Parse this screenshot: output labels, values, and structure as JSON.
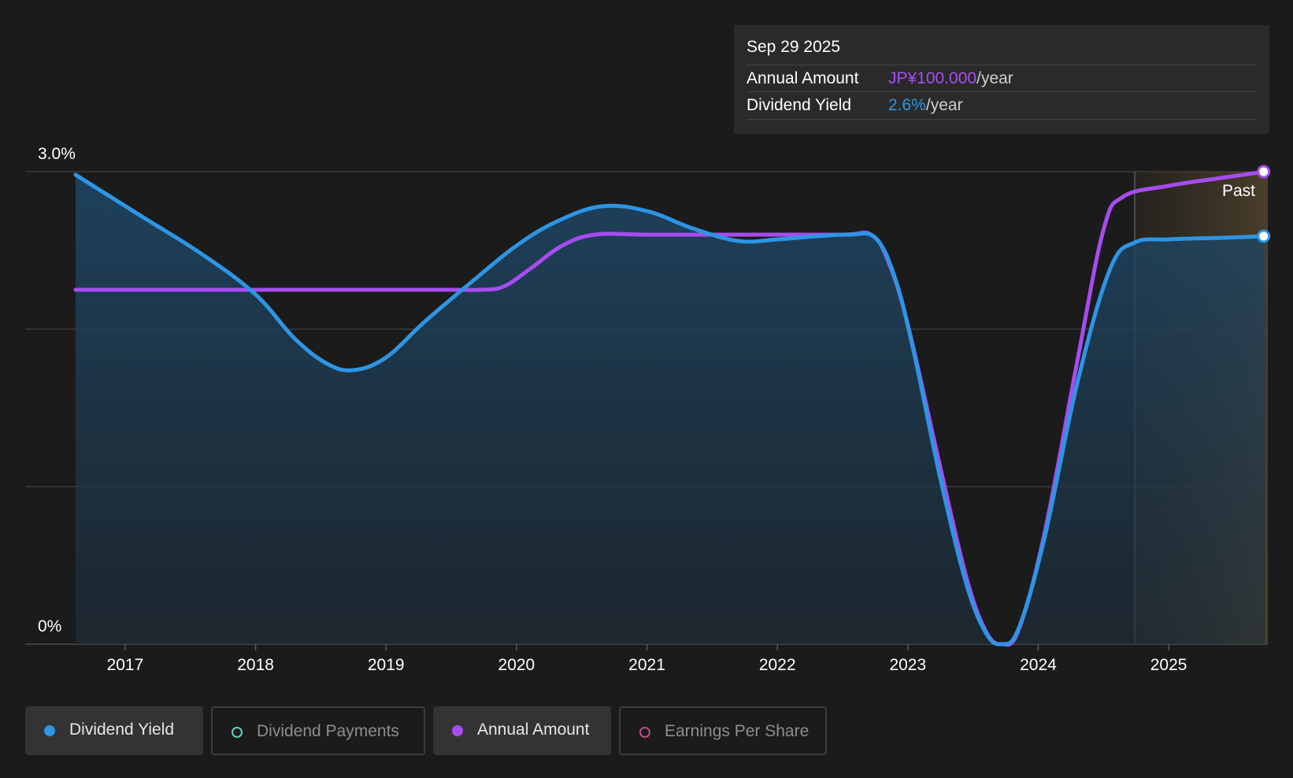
{
  "tooltip": {
    "date": "Sep 29 2025",
    "rows": [
      {
        "label": "Annual Amount",
        "value": "JP¥100.000",
        "unit": "/year"
      },
      {
        "label": "Dividend Yield",
        "value": "2.6%",
        "unit": "/year"
      }
    ]
  },
  "legend": [
    {
      "label": "Dividend Yield",
      "color": "#2d95e4",
      "active": true
    },
    {
      "label": "Dividend Payments",
      "color": "#5fcfbf",
      "active": false
    },
    {
      "label": "Annual Amount",
      "color": "#a74cf0",
      "active": true
    },
    {
      "label": "Earnings Per Share",
      "color": "#c04c8c",
      "active": false
    }
  ],
  "colors": {
    "background": "#1b1b1b",
    "dividend_yield": "#2d95e4",
    "annual_amount": "#a74cf0",
    "forecast_band": "#4a3d2a"
  },
  "chart_data": {
    "type": "line",
    "title": "",
    "xlabel": "",
    "ylabel": "",
    "xlim": [
      2016.62,
      2025.76
    ],
    "ylim": [
      0,
      3.0
    ],
    "y_ticks": [
      {
        "value": 3.0,
        "label": "3.0%"
      },
      {
        "value": 0,
        "label": "0%"
      }
    ],
    "gridlines": [
      3.0,
      2.0,
      1.0,
      0
    ],
    "x_ticks": [
      2017,
      2018,
      2019,
      2020,
      2021,
      2022,
      2023,
      2024,
      2025
    ],
    "x_tick_labels": [
      "2017",
      "2018",
      "2019",
      "2020",
      "2021",
      "2022",
      "2023",
      "2024",
      "2025"
    ],
    "past_marker": {
      "x": 2024.74,
      "label": "Past"
    },
    "series": [
      {
        "name": "Dividend Yield",
        "unit": "%",
        "points": [
          [
            2016.62,
            2.98
          ],
          [
            2017.1,
            2.73
          ],
          [
            2017.6,
            2.47
          ],
          [
            2018.0,
            2.22
          ],
          [
            2018.3,
            1.94
          ],
          [
            2018.55,
            1.78
          ],
          [
            2018.75,
            1.74
          ],
          [
            2019.0,
            1.82
          ],
          [
            2019.3,
            2.05
          ],
          [
            2019.7,
            2.33
          ],
          [
            2020.0,
            2.53
          ],
          [
            2020.3,
            2.68
          ],
          [
            2020.65,
            2.78
          ],
          [
            2021.0,
            2.75
          ],
          [
            2021.35,
            2.64
          ],
          [
            2021.7,
            2.56
          ],
          [
            2022.0,
            2.57
          ],
          [
            2022.3,
            2.59
          ],
          [
            2022.55,
            2.6
          ],
          [
            2022.75,
            2.58
          ],
          [
            2022.9,
            2.33
          ],
          [
            2023.05,
            1.84
          ],
          [
            2023.25,
            1.05
          ],
          [
            2023.45,
            0.38
          ],
          [
            2023.6,
            0.07
          ],
          [
            2023.72,
            0.0
          ],
          [
            2023.85,
            0.1
          ],
          [
            2024.05,
            0.68
          ],
          [
            2024.3,
            1.66
          ],
          [
            2024.55,
            2.38
          ],
          [
            2024.74,
            2.55
          ],
          [
            2025.0,
            2.57
          ],
          [
            2025.4,
            2.58
          ],
          [
            2025.74,
            2.59
          ]
        ]
      },
      {
        "name": "Annual Amount",
        "unit": "JP¥",
        "points": [
          [
            2016.62,
            2.25
          ],
          [
            2017.5,
            2.25
          ],
          [
            2018.5,
            2.25
          ],
          [
            2019.5,
            2.25
          ],
          [
            2019.72,
            2.25
          ],
          [
            2019.9,
            2.27
          ],
          [
            2020.1,
            2.38
          ],
          [
            2020.35,
            2.53
          ],
          [
            2020.6,
            2.6
          ],
          [
            2021.0,
            2.6
          ],
          [
            2021.8,
            2.6
          ],
          [
            2022.5,
            2.6
          ],
          [
            2022.72,
            2.6
          ],
          [
            2022.85,
            2.43
          ],
          [
            2023.0,
            2.03
          ],
          [
            2023.25,
            1.12
          ],
          [
            2023.45,
            0.42
          ],
          [
            2023.6,
            0.08
          ],
          [
            2023.72,
            0.0
          ],
          [
            2023.85,
            0.09
          ],
          [
            2024.05,
            0.71
          ],
          [
            2024.3,
            1.8
          ],
          [
            2024.5,
            2.63
          ],
          [
            2024.65,
            2.84
          ],
          [
            2025.0,
            2.91
          ],
          [
            2025.4,
            2.96
          ],
          [
            2025.74,
            3.0
          ]
        ]
      }
    ]
  }
}
